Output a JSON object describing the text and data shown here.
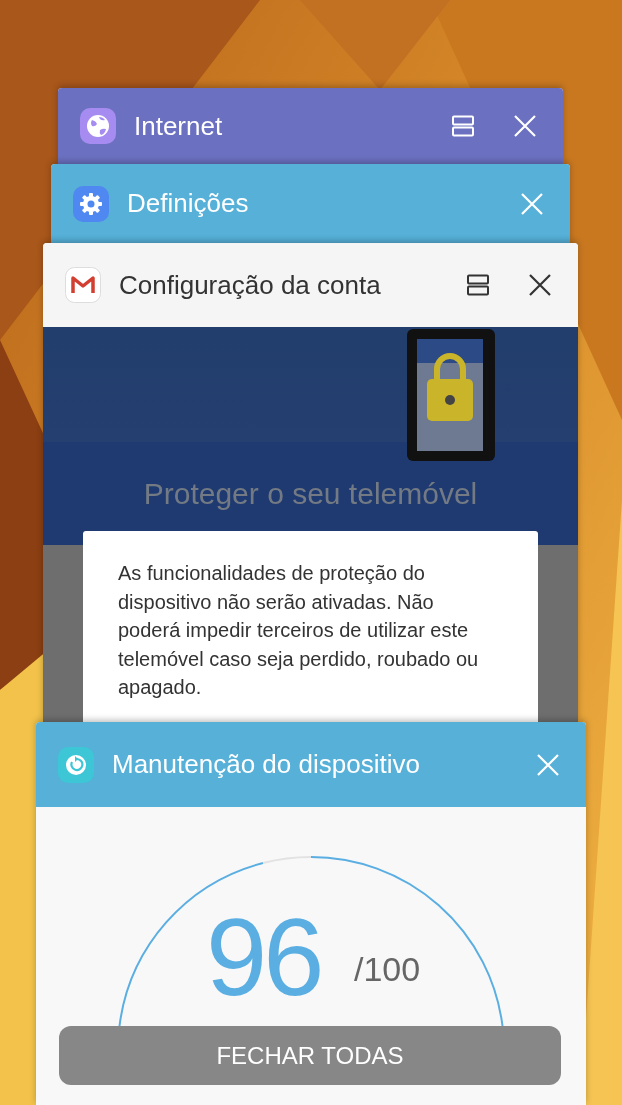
{
  "cards": [
    {
      "title": "Internet",
      "color": "#6b70c0",
      "split_screen": true
    },
    {
      "title": "Definições",
      "color": "#56b0d8",
      "split_screen": false
    },
    {
      "title": "Configuração da conta",
      "color": "#f5f5f5",
      "split_screen": true,
      "preview": {
        "kind": "dialog",
        "heading": "Proteger o seu telemóvel",
        "message": "As funcionalidades de proteção do dispositivo não serão ativadas. Não poderá impedir terceiros de utilizar este telemóvel caso seja perdido, roubado ou apagado."
      }
    },
    {
      "title": "Manutenção do dispositivo",
      "color": "#56b0d8",
      "split_screen": false,
      "preview": {
        "kind": "gauge",
        "score": "96",
        "max": "/100"
      }
    }
  ],
  "close_all": "FECHAR TODAS"
}
